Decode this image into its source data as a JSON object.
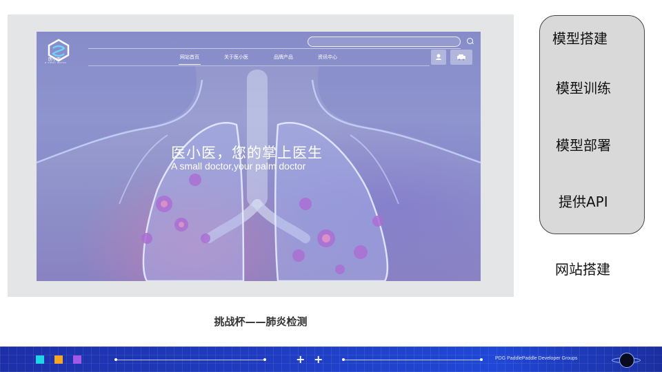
{
  "slide": {
    "caption": "挑战杯——肺炎检测",
    "side_panel": {
      "items": [
        "模型搭建",
        "模型训练",
        "模型部署",
        "提供API"
      ]
    },
    "below_panel": "网站搭建"
  },
  "website": {
    "logo_text": "医小医",
    "logo_sub": "a small doctor",
    "nav": [
      "网站首页",
      "关于医小医",
      "品牌产品",
      "资讯中心"
    ],
    "hero_title": "医小医，您的掌上医生",
    "hero_subtitle": "A small doctor,your palm doctor",
    "icons": [
      "search-icon",
      "user-icon",
      "car-icon"
    ]
  },
  "footer": {
    "text": "PDG PaddlePaddle Developer Groups",
    "colors": [
      "#1ed6e6",
      "#f5a623",
      "#a259e6"
    ]
  }
}
